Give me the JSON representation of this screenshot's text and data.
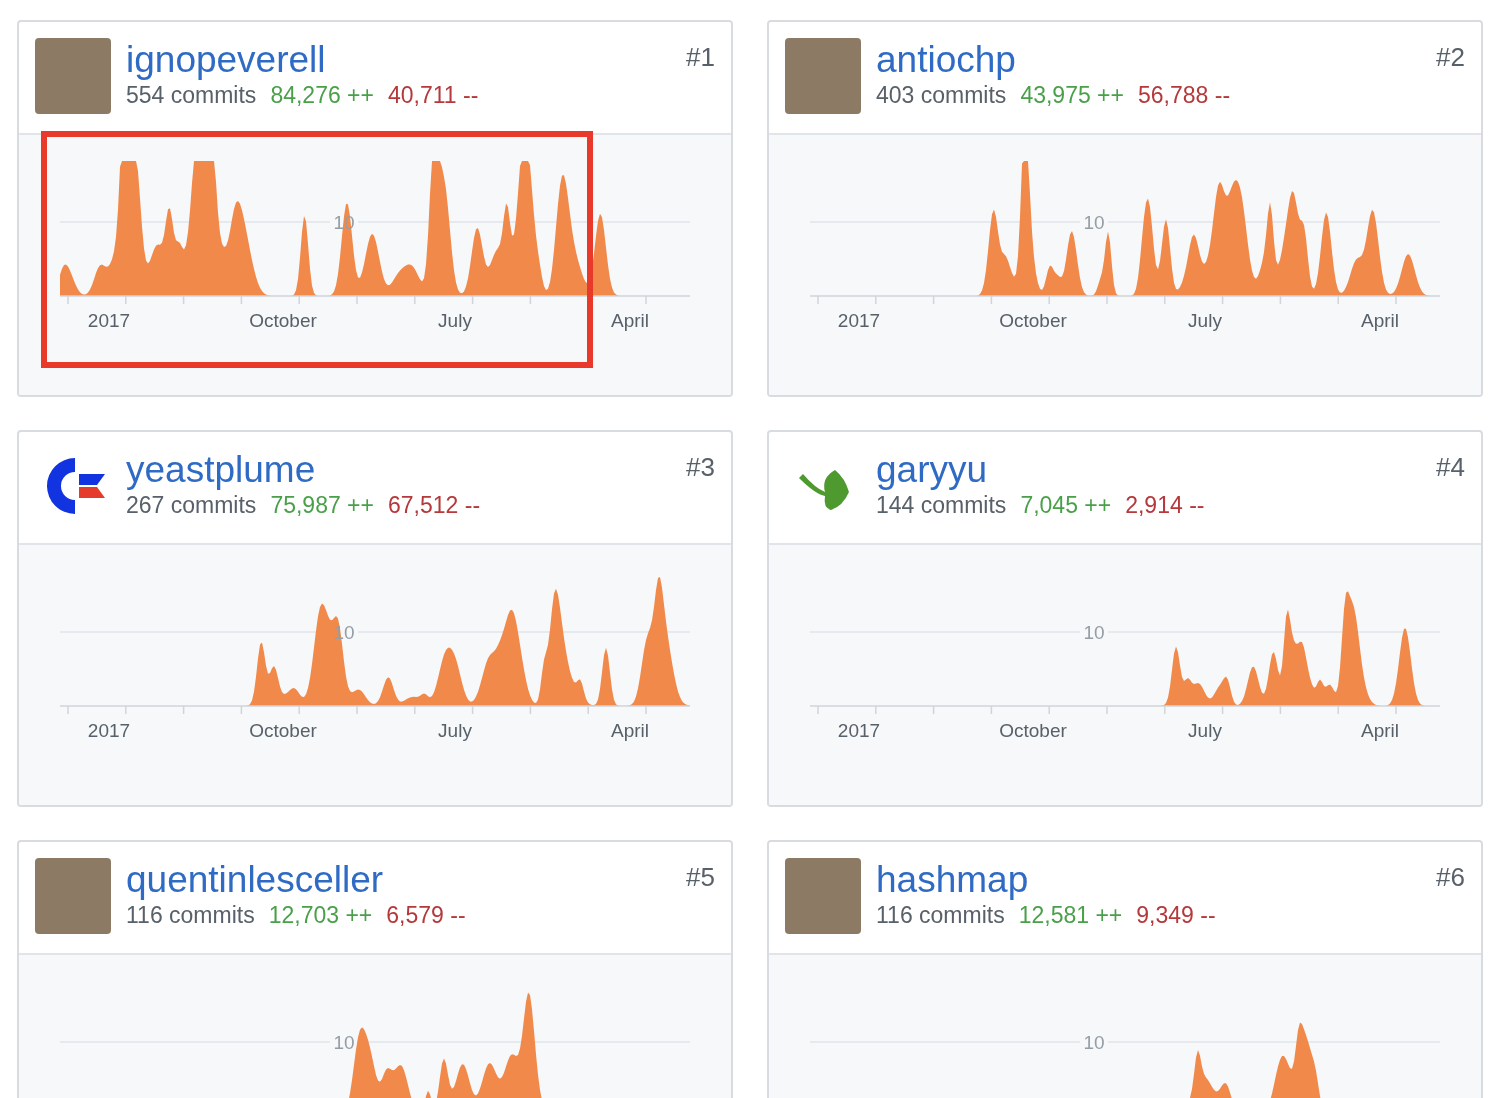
{
  "contributors": [
    {
      "username": "ignopeverell",
      "avatar": {
        "kind": "photo"
      },
      "rank": "#1",
      "commits": "554 commits",
      "additions": "84,276 ++",
      "deletions": "40,711 --",
      "highlighted": true,
      "gridline_label": "10",
      "x_labels": [
        "2017",
        "October",
        "July",
        "April"
      ]
    },
    {
      "username": "antiochp",
      "avatar": {
        "kind": "photo"
      },
      "rank": "#2",
      "commits": "403 commits",
      "additions": "43,975 ++",
      "deletions": "56,788 --",
      "highlighted": false,
      "gridline_label": "10",
      "x_labels": [
        "2017",
        "October",
        "July",
        "April"
      ]
    },
    {
      "username": "yeastplume",
      "avatar": {
        "kind": "c-logo"
      },
      "rank": "#3",
      "commits": "267 commits",
      "additions": "75,987 ++",
      "deletions": "67,512 --",
      "highlighted": false,
      "gridline_label": "10",
      "x_labels": [
        "2017",
        "October",
        "July",
        "April"
      ]
    },
    {
      "username": "garyyu",
      "avatar": {
        "kind": "leaf"
      },
      "rank": "#4",
      "commits": "144 commits",
      "additions": "7,045 ++",
      "deletions": "2,914 --",
      "highlighted": false,
      "gridline_label": "10",
      "x_labels": [
        "2017",
        "October",
        "July",
        "April"
      ]
    },
    {
      "username": "quentinlesceller",
      "avatar": {
        "kind": "photo"
      },
      "rank": "#5",
      "commits": "116 commits",
      "additions": "12,703 ++",
      "deletions": "6,579 --",
      "highlighted": false,
      "gridline_label": "10"
    },
    {
      "username": "hashmap",
      "avatar": {
        "kind": "photo"
      },
      "rank": "#6",
      "commits": "116 commits",
      "additions": "12,581 ++",
      "deletions": "9,349 --",
      "highlighted": false,
      "gridline_label": "10"
    }
  ]
}
